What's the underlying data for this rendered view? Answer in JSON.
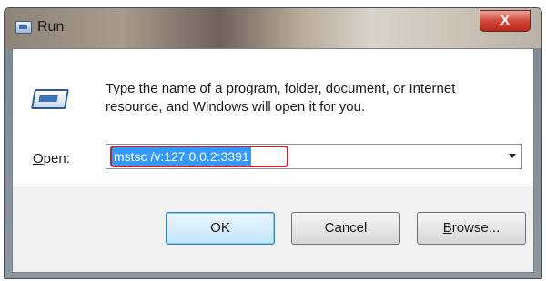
{
  "window": {
    "title": "Run",
    "close_label": "X"
  },
  "dialog": {
    "description": "Type the name of a program, folder, document, or Internet resource, and Windows will open it for you.",
    "open_label_prefix": "O",
    "open_label_rest": "pen:",
    "open_value": "mstsc /v:127.0.0.2:3391"
  },
  "buttons": {
    "ok": "OK",
    "cancel": "Cancel",
    "browse_prefix": "B",
    "browse_rest": "rowse..."
  },
  "colors": {
    "selection": "#3399ff",
    "highlight_box": "#c8232c",
    "close_button": "#d2473a"
  }
}
